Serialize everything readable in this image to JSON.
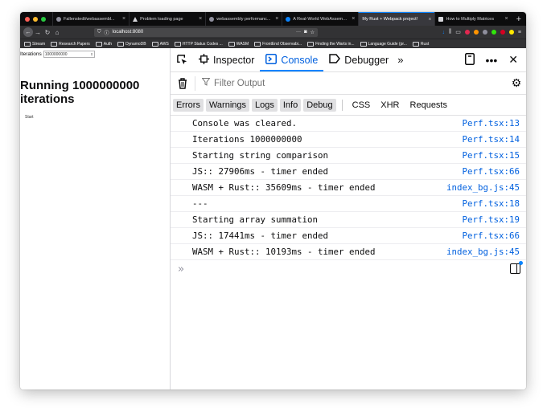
{
  "browser": {
    "tabs": [
      {
        "title": "Fallenstedt/webassembl...",
        "active": false
      },
      {
        "title": "Problem loading page",
        "active": false
      },
      {
        "title": "webassembly performanc...",
        "active": false
      },
      {
        "title": "A Real-World WebAssembl...",
        "active": false
      },
      {
        "title": "My Rust + Webpack project!",
        "active": true
      },
      {
        "title": "How to Multiply Matrices",
        "active": false
      }
    ],
    "new_tab": "+",
    "tab_close": "×",
    "url": "localhost:8080",
    "url_menu": "···",
    "bookmarks": [
      "Stream",
      "Research Papers",
      "Auth",
      "DynamoDB",
      "AWS",
      "HTTP Status Codes ...",
      "WASM",
      "FrontEnd Observabi...",
      "Finding the Warts in...",
      "Language Guide (pr...",
      "Rust"
    ]
  },
  "page": {
    "iterations_label": "Iterations",
    "iterations_value": "1000000000",
    "heading": "Running 1000000000 iterations",
    "start_button": "Start"
  },
  "devtools": {
    "tabs": {
      "inspector": "Inspector",
      "console": "Console",
      "debugger": "Debugger"
    },
    "filter_placeholder": "Filter Output",
    "levels": [
      "Errors",
      "Warnings",
      "Logs",
      "Info",
      "Debug"
    ],
    "categories": [
      "CSS",
      "XHR",
      "Requests"
    ],
    "messages": [
      {
        "text": "Console was cleared.",
        "source": "Perf.tsx:13"
      },
      {
        "text": "Iterations 1000000000",
        "source": "Perf.tsx:14"
      },
      {
        "text": "Starting string comparison",
        "source": "Perf.tsx:15"
      },
      {
        "text": "JS:: 27906ms - timer ended",
        "source": "Perf.tsx:66"
      },
      {
        "text": "WASM + Rust:: 35609ms - timer ended",
        "source": "index_bg.js:45"
      },
      {
        "text": "---",
        "source": "Perf.tsx:18"
      },
      {
        "text": "Starting array summation",
        "source": "Perf.tsx:19"
      },
      {
        "text": "JS:: 17441ms - timer ended",
        "source": "Perf.tsx:66"
      },
      {
        "text": "WASM + Rust:: 10193ms - timer ended",
        "source": "index_bg.js:45"
      }
    ],
    "prompt": "»"
  },
  "colors": {
    "accent": "#0a84ff",
    "link": "#0060df",
    "chrome_dark": "#0c0c0d",
    "traffic_red": "#ff5f57",
    "traffic_yellow": "#febc2e",
    "traffic_green": "#28c840"
  }
}
